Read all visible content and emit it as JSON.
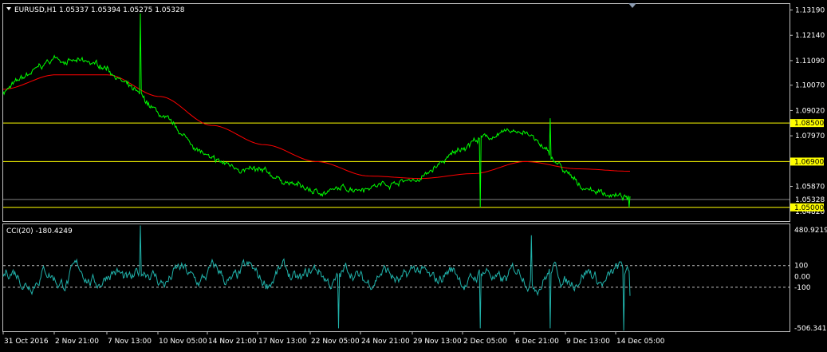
{
  "main_chart": {
    "symbol_line": "EURUSD,H1  1.05337 1.05394 1.05275 1.05328",
    "price_range": [
      1.0443,
      1.1344
    ],
    "price_ticks": [
      "1.13190",
      "1.12140",
      "1.11090",
      "1.10070",
      "1.09020",
      "1.07970",
      "1.05870"
    ],
    "hlines": [
      {
        "value": 1.085,
        "label": "1.08500",
        "color": "#ffff00"
      },
      {
        "value": 1.069,
        "label": "1.06900",
        "color": "#ffff00"
      },
      {
        "value": 1.05,
        "label": "1.05000",
        "color": "#ffff00"
      }
    ],
    "current_price": {
      "value": 1.05328,
      "label": "1.05328"
    },
    "partial_tick": "1.04820"
  },
  "indicator": {
    "title": "CCI(20) -180.4249",
    "range": [
      -506.3417,
      480.9219
    ],
    "max_label": "480.9219",
    "min_label": "-506.3417",
    "levels": [
      {
        "value": 100,
        "label": "100"
      },
      {
        "value": 0,
        "label": "0.00"
      },
      {
        "value": -100,
        "label": "-100"
      }
    ]
  },
  "time_axis": [
    "31 Oct 2016",
    "2 Nov 21:00",
    "7 Nov 13:00",
    "10 Nov 05:00",
    "14 Nov 21:00",
    "17 Nov 13:00",
    "22 Nov 05:00",
    "24 Nov 21:00",
    "29 Nov 13:00",
    "2 Dec 05:00",
    "6 Dec 21:00",
    "9 Dec 13:00",
    "14 Dec 05:00"
  ],
  "colors": {
    "background": "#000000",
    "price_line": "#00ff00",
    "moving_average": "#ff0000",
    "cci_line": "#20b2aa",
    "grid_frame": "#c0c0c0",
    "label_highlight": "#ffff00"
  },
  "chart_data": {
    "type": "line",
    "title": "EURUSD,H1  1.05337 1.05394 1.05275 1.05328",
    "x": [
      "31 Oct 2016",
      "2 Nov 21:00",
      "7 Nov 13:00",
      "10 Nov 05:00",
      "14 Nov 21:00",
      "17 Nov 13:00",
      "22 Nov 05:00",
      "24 Nov 21:00",
      "29 Nov 13:00",
      "2 Dec 05:00",
      "6 Dec 21:00",
      "9 Dec 13:00",
      "14 Dec 05:00"
    ],
    "series": [
      {
        "values": [
          1.098,
          1.112,
          1.108,
          1.088,
          1.069,
          1.064,
          1.056,
          1.059,
          1.062,
          1.078,
          1.082,
          1.059,
          1.0533
        ]
      },
      {
        "values": [
          1.099,
          1.105,
          1.105,
          1.096,
          1.084,
          1.076,
          1.069,
          1.063,
          1.062,
          1.064,
          1.069,
          1.066,
          1.065
        ]
      }
    ],
    "ylim": [
      1.0443,
      1.1344
    ],
    "grid": false
  }
}
